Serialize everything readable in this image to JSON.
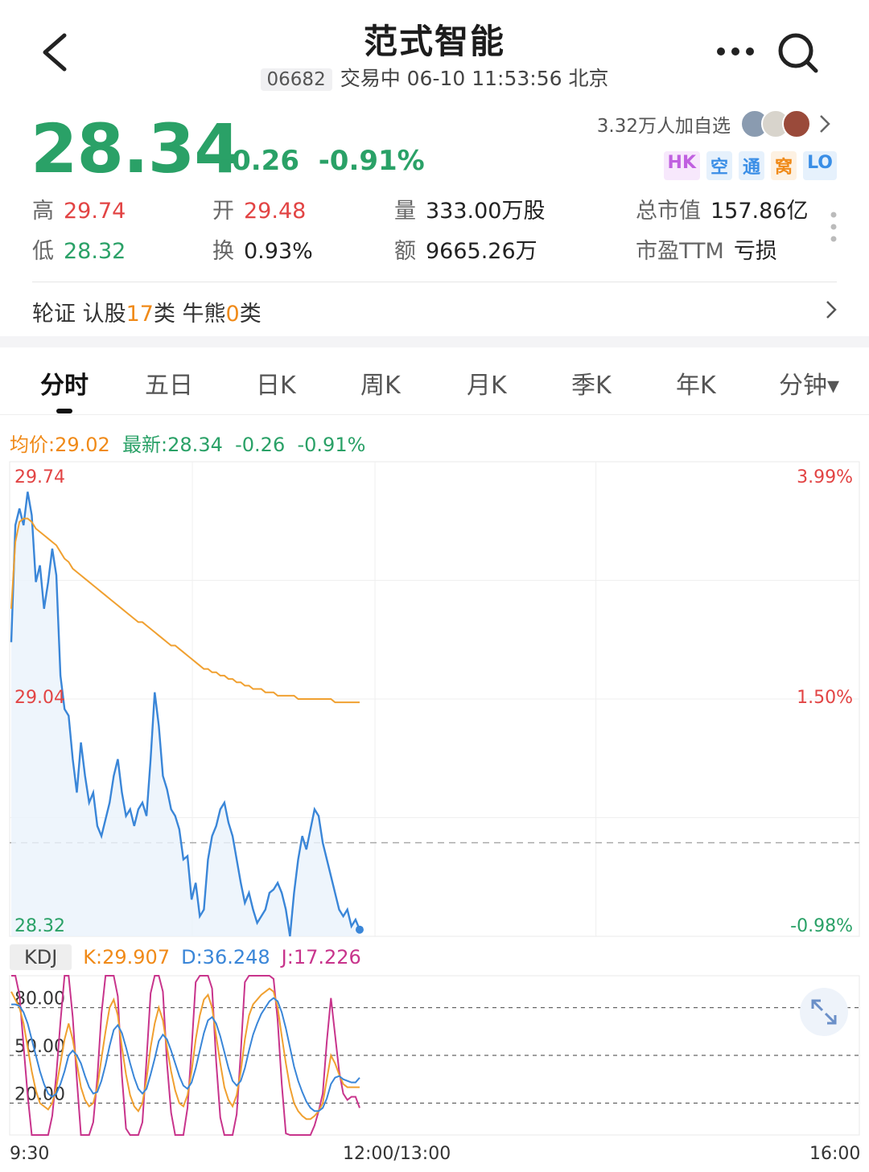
{
  "header": {
    "title": "范式智能",
    "code": "06682",
    "status_time": "交易中 06-10 11:53:56 北京"
  },
  "quote": {
    "price": "28.34",
    "change": "-0.26",
    "change_pct": "-0.91%",
    "watchers": "3.32万人加自选",
    "tags": [
      {
        "text": "HK",
        "color": "#c060e0",
        "bg": "#f7e8fc"
      },
      {
        "text": "空",
        "color": "#3a8ee6",
        "bg": "#e6f1fc"
      },
      {
        "text": "通",
        "color": "#3a8ee6",
        "bg": "#e6f1fc"
      },
      {
        "text": "窝",
        "color": "#f08a18",
        "bg": "#fdf1e2"
      },
      {
        "text": "LO",
        "color": "#3a8ee6",
        "bg": "#e6f1fc"
      }
    ]
  },
  "stats": {
    "high_label": "高",
    "high": "29.74",
    "low_label": "低",
    "low": "28.32",
    "open_label": "开",
    "open": "29.48",
    "turnover_label": "换",
    "turnover": "0.93%",
    "volume_label": "量",
    "volume": "333.00万股",
    "amount_label": "额",
    "amount": "9665.26万",
    "mktcap_label": "总市值",
    "mktcap": "157.86亿",
    "pe_label": "市盈TTM",
    "pe": "亏损"
  },
  "warrants": {
    "prefix": "轮证  认股",
    "call_count": "17",
    "mid": "类  牛熊",
    "cbbc_count": "0",
    "suffix": "类"
  },
  "tabs": [
    "分时",
    "五日",
    "日K",
    "周K",
    "月K",
    "季K",
    "年K",
    "分钟▾"
  ],
  "legend": {
    "avg": "均价:29.02",
    "latest": "最新:28.34",
    "change": "-0.26",
    "change_pct": "-0.91%"
  },
  "kdj": {
    "label": "KDJ",
    "k": "K:29.907",
    "d": "D:36.248",
    "j": "J:17.226",
    "levels": [
      "80.00",
      "50.00",
      "20.00"
    ]
  },
  "colors": {
    "up": "#e24444",
    "down": "#2aa167",
    "price_line": "#3a86d8",
    "avg_line": "#f0a030",
    "j_line": "#c8348c"
  },
  "chart_data": {
    "type": "line",
    "title": "",
    "ylim": [
      28.32,
      29.74
    ],
    "y_left_ticks": [
      "29.74",
      "29.04",
      "28.32"
    ],
    "y_right_ticks": [
      "3.99%",
      "1.50%",
      "-0.98%"
    ],
    "prev_close": 28.6,
    "x_ticks": [
      "9:30",
      "12:00/13:00",
      "16:00"
    ],
    "series": [
      {
        "name": "最新",
        "values": [
          29.2,
          29.55,
          29.6,
          29.55,
          29.65,
          29.58,
          29.38,
          29.43,
          29.3,
          29.38,
          29.48,
          29.4,
          29.1,
          29.0,
          28.98,
          28.85,
          28.75,
          28.9,
          28.8,
          28.72,
          28.75,
          28.65,
          28.62,
          28.67,
          28.72,
          28.8,
          28.85,
          28.75,
          28.68,
          28.7,
          28.65,
          28.7,
          28.72,
          28.68,
          28.85,
          29.05,
          28.95,
          28.8,
          28.76,
          28.7,
          28.68,
          28.64,
          28.55,
          28.56,
          28.43,
          28.48,
          28.38,
          28.4,
          28.55,
          28.62,
          28.65,
          28.7,
          28.72,
          28.66,
          28.62,
          28.55,
          28.48,
          28.42,
          28.45,
          28.4,
          28.36,
          28.38,
          28.4,
          28.45,
          28.46,
          28.48,
          28.45,
          28.4,
          28.32,
          28.45,
          28.55,
          28.62,
          28.58,
          28.64,
          28.7,
          28.68,
          28.6,
          28.55,
          28.5,
          28.45,
          28.4,
          28.38,
          28.4,
          28.35,
          28.37,
          28.34
        ]
      },
      {
        "name": "均价",
        "values": [
          29.3,
          29.5,
          29.56,
          29.57,
          29.57,
          29.56,
          29.54,
          29.53,
          29.52,
          29.51,
          29.5,
          29.49,
          29.47,
          29.45,
          29.44,
          29.42,
          29.41,
          29.4,
          29.39,
          29.38,
          29.37,
          29.36,
          29.35,
          29.34,
          29.33,
          29.32,
          29.31,
          29.3,
          29.29,
          29.28,
          29.27,
          29.26,
          29.26,
          29.25,
          29.24,
          29.23,
          29.22,
          29.21,
          29.2,
          29.19,
          29.19,
          29.18,
          29.17,
          29.16,
          29.15,
          29.14,
          29.13,
          29.12,
          29.12,
          29.11,
          29.11,
          29.1,
          29.1,
          29.09,
          29.09,
          29.08,
          29.08,
          29.07,
          29.07,
          29.06,
          29.06,
          29.06,
          29.05,
          29.05,
          29.05,
          29.04,
          29.04,
          29.04,
          29.04,
          29.04,
          29.03,
          29.03,
          29.03,
          29.03,
          29.03,
          29.03,
          29.03,
          29.03,
          29.03,
          29.02,
          29.02,
          29.02,
          29.02,
          29.02,
          29.02,
          29.02
        ]
      }
    ],
    "kdj_series": [
      {
        "name": "K",
        "values": [
          90,
          85,
          80,
          70,
          55,
          40,
          28,
          20,
          18,
          16,
          20,
          30,
          45,
          60,
          70,
          60,
          45,
          30,
          22,
          18,
          20,
          30,
          48,
          65,
          80,
          85,
          75,
          55,
          38,
          25,
          18,
          15,
          20,
          35,
          55,
          70,
          80,
          72,
          55,
          40,
          28,
          20,
          18,
          25,
          40,
          60,
          75,
          85,
          88,
          80,
          62,
          45,
          30,
          22,
          18,
          25,
          40,
          60,
          75,
          82,
          85,
          88,
          90,
          92,
          90,
          80,
          62,
          45,
          30,
          20,
          15,
          12,
          10,
          10,
          12,
          15,
          20,
          35,
          50,
          45,
          38,
          32,
          30,
          30,
          30,
          30
        ]
      },
      {
        "name": "D",
        "values": [
          82,
          82,
          81,
          77,
          70,
          60,
          50,
          40,
          32,
          26,
          24,
          26,
          32,
          40,
          50,
          53,
          50,
          45,
          37,
          30,
          26,
          27,
          34,
          44,
          56,
          66,
          69,
          64,
          55,
          45,
          36,
          29,
          26,
          29,
          38,
          48,
          59,
          63,
          60,
          53,
          45,
          37,
          31,
          29,
          33,
          42,
          53,
          64,
          72,
          74,
          70,
          62,
          52,
          42,
          34,
          31,
          34,
          42,
          53,
          63,
          70,
          76,
          80,
          84,
          86,
          84,
          77,
          67,
          55,
          43,
          34,
          27,
          21,
          17,
          15,
          15,
          17,
          23,
          32,
          36,
          37,
          35,
          34,
          33,
          33,
          36
        ]
      },
      {
        "name": "J",
        "values": [
          100,
          100,
          88,
          56,
          25,
          0,
          0,
          0,
          0,
          0,
          12,
          38,
          71,
          100,
          100,
          74,
          35,
          0,
          0,
          0,
          8,
          36,
          76,
          100,
          100,
          100,
          87,
          37,
          4,
          0,
          0,
          0,
          8,
          47,
          89,
          100,
          100,
          90,
          45,
          14,
          0,
          0,
          0,
          17,
          54,
          96,
          100,
          100,
          100,
          92,
          46,
          11,
          0,
          0,
          0,
          13,
          52,
          96,
          100,
          100,
          100,
          100,
          100,
          100,
          98,
          72,
          32,
          1,
          0,
          0,
          0,
          0,
          0,
          0,
          6,
          15,
          26,
          59,
          86,
          63,
          40,
          26,
          22,
          24,
          24,
          17
        ]
      }
    ]
  }
}
